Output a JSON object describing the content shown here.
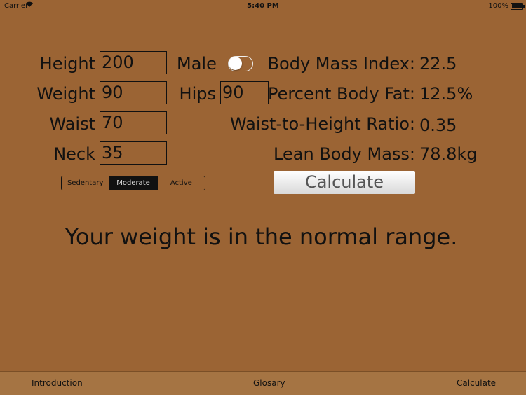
{
  "status_bar": {
    "carrier": "Carrier",
    "time": "5:40 PM",
    "battery": "100%"
  },
  "form": {
    "height_label": "Height",
    "height_value": "200",
    "weight_label": "Weight",
    "weight_value": "90",
    "waist_label": "Waist",
    "waist_value": "70",
    "neck_label": "Neck",
    "neck_value": "35",
    "gender_label": "Male",
    "hips_label": "Hips",
    "hips_value": "90"
  },
  "activity": {
    "options": [
      "Sedentary",
      "Moderate",
      "Active"
    ],
    "selected": "Moderate"
  },
  "results": {
    "bmi_label": "Body Mass Index:",
    "bmi_value": "22.5",
    "bodyfat_label": "Percent Body Fat:",
    "bodyfat_value": "12.5%",
    "whr_label": "Waist-to-Height Ratio:",
    "whr_value": "0.35",
    "lbm_label": "Lean Body Mass:",
    "lbm_value": "78.8kg"
  },
  "calculate_button": "Calculate",
  "message": "Your weight is in the normal range.",
  "tabs": [
    "Introduction",
    "Glosary",
    "Calculate"
  ],
  "colors": {
    "background": "#9b6434",
    "tabbar": "#a57443",
    "text": "#111111"
  }
}
